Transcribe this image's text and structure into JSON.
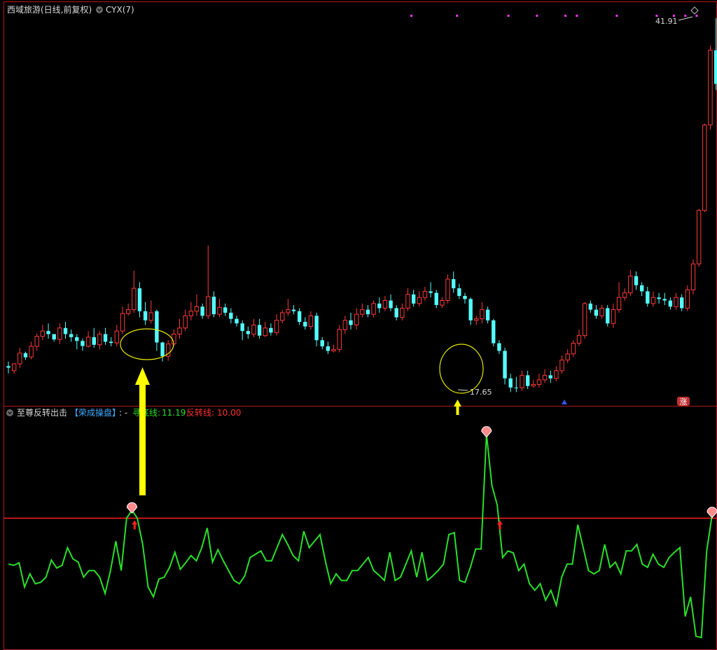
{
  "colors": {
    "up": "#ff3b3b",
    "down": "#54ffff",
    "osc_line": "#29e029",
    "threshold": "#ff2020",
    "frame": "#b01818",
    "arrow": "#ffff00",
    "ellipse": "#e6e600",
    "marker": "#ff33ff"
  },
  "top_panel": {
    "title": "西域旅游(日线,前复权)",
    "indicator": "CYX(7)",
    "high_label": "41.91",
    "low_label": "17.65",
    "zhang_badge": "涨"
  },
  "bottom_panel": {
    "title": "至尊反转出击",
    "subtitle": "【荣成操盘】",
    "sep": ": -",
    "line1_name": "寻底线:",
    "line1_value": "11.19",
    "line2_name": "反转线:",
    "line2_value": "10.00"
  },
  "chart_data": [
    {
      "type": "candlestick",
      "ylim": [
        16.5,
        43.0
      ],
      "series": [
        {
          "name": "candles",
          "ohlc": [
            [
              19.1,
              19.0,
              18.62,
              19.4
            ],
            [
              18.8,
              19.25,
              18.6,
              19.3
            ],
            [
              19.25,
              19.95,
              19.0,
              20.3
            ],
            [
              19.95,
              19.68,
              19.5,
              20.05
            ],
            [
              19.7,
              20.4,
              19.55,
              20.7
            ],
            [
              20.4,
              21.05,
              20.1,
              21.25
            ],
            [
              21.05,
              21.4,
              20.8,
              21.8
            ],
            [
              21.4,
              21.2,
              20.9,
              21.9
            ],
            [
              21.2,
              20.85,
              20.7,
              21.1
            ],
            [
              20.85,
              21.6,
              20.55,
              21.9
            ],
            [
              21.6,
              21.2,
              20.9,
              22.0
            ],
            [
              21.2,
              21.0,
              20.7,
              21.5
            ],
            [
              21.0,
              20.75,
              20.2,
              21.2
            ],
            [
              20.75,
              20.42,
              20.1,
              20.9
            ],
            [
              20.4,
              21.0,
              20.3,
              21.4
            ],
            [
              21.0,
              20.5,
              20.3,
              21.6
            ],
            [
              20.5,
              21.2,
              20.2,
              21.4
            ],
            [
              21.2,
              20.7,
              20.5,
              21.6
            ],
            [
              20.7,
              20.62,
              20.4,
              21.0
            ],
            [
              20.62,
              21.4,
              20.4,
              21.8
            ],
            [
              21.4,
              22.55,
              21.2,
              23.0
            ],
            [
              22.55,
              22.8,
              22.4,
              23.2
            ],
            [
              22.8,
              24.2,
              22.6,
              25.35
            ],
            [
              24.2,
              22.7,
              22.3,
              24.6
            ],
            [
              22.7,
              22.1,
              21.8,
              23.3
            ],
            [
              22.1,
              22.6,
              21.9,
              23.4
            ],
            [
              22.7,
              20.65,
              20.1,
              22.8
            ],
            [
              20.65,
              19.75,
              19.4,
              20.7
            ],
            [
              19.75,
              20.55,
              19.45,
              20.8
            ],
            [
              20.55,
              21.2,
              20.4,
              21.5
            ],
            [
              21.2,
              21.6,
              20.9,
              22.2
            ],
            [
              21.6,
              22.4,
              21.4,
              22.8
            ],
            [
              22.4,
              22.7,
              22.1,
              23.3
            ],
            [
              22.7,
              23.0,
              22.4,
              23.8
            ],
            [
              23.0,
              22.4,
              22.2,
              23.2
            ],
            [
              22.4,
              23.65,
              22.2,
              27.0
            ],
            [
              23.65,
              22.5,
              22.3,
              24.0
            ],
            [
              22.5,
              22.95,
              22.3,
              23.5
            ],
            [
              22.95,
              22.6,
              22.4,
              23.2
            ],
            [
              22.6,
              22.2,
              21.9,
              22.9
            ],
            [
              22.2,
              21.9,
              21.7,
              22.4
            ],
            [
              21.9,
              21.4,
              20.8,
              22.1
            ],
            [
              21.4,
              21.2,
              20.9,
              21.7
            ],
            [
              21.2,
              21.8,
              21.0,
              22.2
            ],
            [
              21.8,
              21.1,
              20.9,
              22.2
            ],
            [
              21.1,
              21.6,
              21.0,
              22.0
            ],
            [
              21.6,
              21.3,
              21.1,
              21.9
            ],
            [
              21.3,
              22.1,
              21.1,
              22.5
            ],
            [
              22.1,
              22.6,
              21.9,
              22.8
            ],
            [
              22.6,
              22.8,
              22.4,
              23.5
            ],
            [
              22.8,
              22.7,
              22.5,
              23.1
            ],
            [
              22.7,
              22.0,
              21.8,
              22.9
            ],
            [
              22.0,
              21.7,
              21.5,
              22.3
            ],
            [
              21.7,
              22.4,
              21.5,
              22.7
            ],
            [
              22.4,
              20.8,
              20.4,
              22.6
            ],
            [
              20.8,
              20.4,
              20.2,
              21.0
            ],
            [
              20.4,
              20.1,
              19.9,
              20.7
            ],
            [
              20.1,
              20.2,
              20.0,
              20.5
            ],
            [
              20.2,
              21.5,
              20.0,
              21.8
            ],
            [
              21.5,
              22.1,
              21.2,
              22.4
            ],
            [
              22.1,
              21.8,
              21.5,
              22.6
            ],
            [
              21.8,
              22.5,
              21.5,
              22.9
            ],
            [
              22.5,
              22.8,
              22.3,
              23.2
            ],
            [
              22.8,
              22.5,
              22.3,
              23.1
            ],
            [
              22.5,
              23.2,
              22.3,
              23.4
            ],
            [
              23.2,
              22.9,
              22.6,
              23.6
            ],
            [
              22.9,
              23.4,
              22.7,
              23.7
            ],
            [
              23.4,
              22.9,
              22.7,
              23.8
            ],
            [
              22.9,
              22.3,
              22.1,
              23.1
            ],
            [
              22.3,
              22.9,
              22.1,
              23.2
            ],
            [
              22.9,
              23.8,
              22.7,
              24.2
            ],
            [
              23.8,
              23.2,
              23.0,
              24.1
            ],
            [
              23.2,
              23.6,
              23.0,
              24.0
            ],
            [
              23.6,
              24.0,
              23.4,
              24.3
            ],
            [
              24.0,
              23.9,
              23.6,
              24.6
            ],
            [
              23.9,
              23.1,
              22.9,
              24.1
            ],
            [
              23.1,
              23.4,
              22.9,
              23.6
            ],
            [
              23.4,
              24.8,
              23.2,
              25.1
            ],
            [
              24.8,
              24.2,
              23.9,
              25.3
            ],
            [
              24.2,
              23.7,
              23.5,
              24.5
            ],
            [
              23.7,
              23.5,
              23.2,
              23.9
            ],
            [
              23.5,
              22.1,
              21.8,
              23.6
            ],
            [
              22.1,
              22.2,
              21.8,
              22.4
            ],
            [
              22.2,
              22.8,
              21.9,
              23.3
            ],
            [
              22.8,
              22.1,
              21.9,
              23.0
            ],
            [
              22.1,
              20.6,
              20.4,
              22.2
            ],
            [
              20.6,
              20.1,
              19.9,
              20.8
            ],
            [
              20.1,
              18.3,
              17.9,
              20.3
            ],
            [
              18.3,
              17.7,
              17.4,
              18.6
            ],
            [
              17.7,
              17.68,
              17.4,
              18.4
            ],
            [
              17.68,
              18.5,
              17.5,
              18.8
            ],
            [
              18.5,
              17.8,
              17.6,
              18.8
            ],
            [
              17.8,
              17.9,
              17.7,
              18.2
            ],
            [
              17.9,
              18.2,
              17.7,
              18.6
            ],
            [
              18.2,
              18.5,
              18.0,
              18.9
            ],
            [
              18.5,
              18.3,
              18.0,
              18.8
            ],
            [
              18.3,
              18.8,
              18.1,
              19.1
            ],
            [
              18.8,
              19.5,
              18.6,
              19.8
            ],
            [
              19.5,
              19.9,
              19.3,
              20.2
            ],
            [
              19.9,
              20.6,
              19.7,
              20.8
            ],
            [
              20.6,
              21.1,
              20.4,
              21.5
            ],
            [
              21.1,
              23.2,
              20.9,
              23.3
            ],
            [
              23.2,
              22.8,
              22.6,
              23.4
            ],
            [
              22.8,
              22.4,
              22.2,
              23.1
            ],
            [
              22.4,
              22.9,
              22.2,
              23.1
            ],
            [
              22.9,
              21.9,
              21.7,
              23.1
            ],
            [
              21.9,
              22.8,
              21.6,
              23.2
            ],
            [
              22.8,
              23.6,
              22.6,
              24.6
            ],
            [
              23.6,
              23.9,
              23.4,
              24.2
            ],
            [
              23.9,
              25.0,
              23.7,
              25.4
            ],
            [
              25.0,
              24.4,
              24.1,
              25.3
            ],
            [
              24.4,
              24.0,
              23.7,
              24.6
            ],
            [
              24.0,
              23.2,
              23.0,
              24.3
            ],
            [
              23.2,
              23.6,
              23.0,
              24.0
            ],
            [
              23.6,
              23.5,
              23.2,
              23.9
            ],
            [
              23.5,
              23.4,
              23.1,
              23.9
            ],
            [
              23.4,
              23.0,
              22.8,
              23.6
            ],
            [
              23.0,
              23.6,
              22.8,
              23.9
            ],
            [
              23.6,
              22.9,
              22.7,
              23.8
            ],
            [
              22.9,
              24.1,
              22.7,
              24.4
            ],
            [
              24.1,
              25.8,
              23.8,
              26.1
            ],
            [
              25.8,
              29.3,
              25.6,
              29.4
            ],
            [
              29.3,
              34.9,
              29.2,
              35.0
            ],
            [
              34.9,
              39.8,
              34.6,
              40.1
            ],
            [
              39.8,
              37.6,
              37.2,
              41.91
            ],
            [
              37.6,
              38.9,
              36.8,
              40.6
            ],
            [
              38.9,
              35.4,
              35.1,
              39.3
            ],
            [
              35.4,
              36.5,
              34.6,
              37.6
            ],
            [
              36.5,
              37.3,
              35.6,
              38.3
            ]
          ]
        }
      ]
    },
    {
      "type": "line",
      "ylim": [
        -10,
        25
      ],
      "series": [
        {
          "name": "寻底线",
          "values": [
            3.0,
            2.8,
            3.2,
            -0.5,
            1.5,
            0.0,
            0.2,
            1.0,
            3.6,
            2.4,
            2.8,
            5.5,
            3.8,
            3.3,
            1.0,
            2.0,
            2.0,
            1.0,
            -1.5,
            2.0,
            6.5,
            2.0,
            10.0,
            11.2,
            10.0,
            6.0,
            -0.5,
            -2.0,
            0.7,
            1.0,
            2.5,
            4.8,
            2.2,
            3.2,
            4.3,
            3.5,
            5.5,
            8.5,
            3.3,
            5.2,
            3.5,
            2.0,
            0.5,
            0.0,
            1.2,
            4.0,
            4.5,
            5.0,
            3.5,
            3.5,
            5.5,
            7.5,
            6.0,
            4.3,
            3.5,
            8.0,
            5.5,
            6.5,
            7.5,
            3.5,
            0.0,
            1.5,
            0.5,
            0.5,
            2.0,
            2.0,
            3.0,
            4.0,
            2.0,
            1.3,
            0.5,
            4.8,
            0.5,
            1.0,
            3.0,
            5.0,
            1.0,
            4.8,
            0.5,
            1.2,
            2.0,
            3.0,
            7.5,
            7.8,
            0.5,
            0.2,
            2.5,
            5.3,
            5.3,
            22.8,
            15.0,
            12.0,
            4.0,
            5.0,
            4.7,
            2.0,
            3.0,
            0.0,
            -1.0,
            0.0,
            -2.5,
            -1.0,
            -3.3,
            1.0,
            3.0,
            3.0,
            9.0,
            5.5,
            2.0,
            1.5,
            2.0,
            6.0,
            2.5,
            3.3,
            1.5,
            5.0,
            5.0,
            6.0,
            3.0,
            2.5,
            4.5,
            3.0,
            2.5,
            4.0,
            4.8,
            5.5,
            -5.0,
            -2.0,
            -8.0,
            -8.2,
            5.0,
            10.5
          ]
        },
        {
          "name": "反转线",
          "values": [
            10.0
          ]
        }
      ]
    }
  ]
}
